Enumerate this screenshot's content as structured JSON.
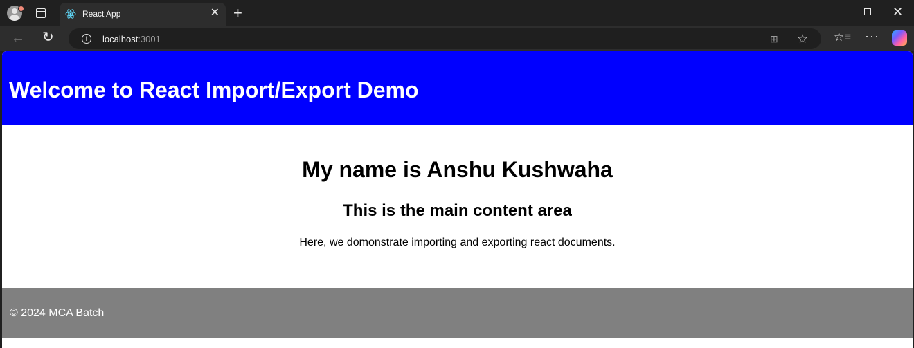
{
  "browser": {
    "tab_title": "React App",
    "tab_close": "✕",
    "new_tab": "+",
    "url_host": "localhost",
    "url_port": ":3001"
  },
  "app": {
    "header_title": "Welcome to React Import/Export Demo",
    "name_heading": "My name is Anshu Kushwaha",
    "content_heading": "This is the main content area",
    "description": "Here, we domonstrate importing and exporting react documents.",
    "footer_text": "© 2024 MCA Batch"
  },
  "colors": {
    "header_bg": "#0000ff",
    "footer_bg": "#808080"
  },
  "icons": [
    "profile-icon",
    "tab-actions-icon",
    "react-icon",
    "close-icon",
    "new-tab-icon",
    "minimize-icon",
    "maximize-icon",
    "window-close-icon",
    "back-icon",
    "reload-icon",
    "info-icon",
    "apps-icon",
    "favorite-star-icon",
    "favorites-icon",
    "more-icon",
    "copilot-icon"
  ]
}
